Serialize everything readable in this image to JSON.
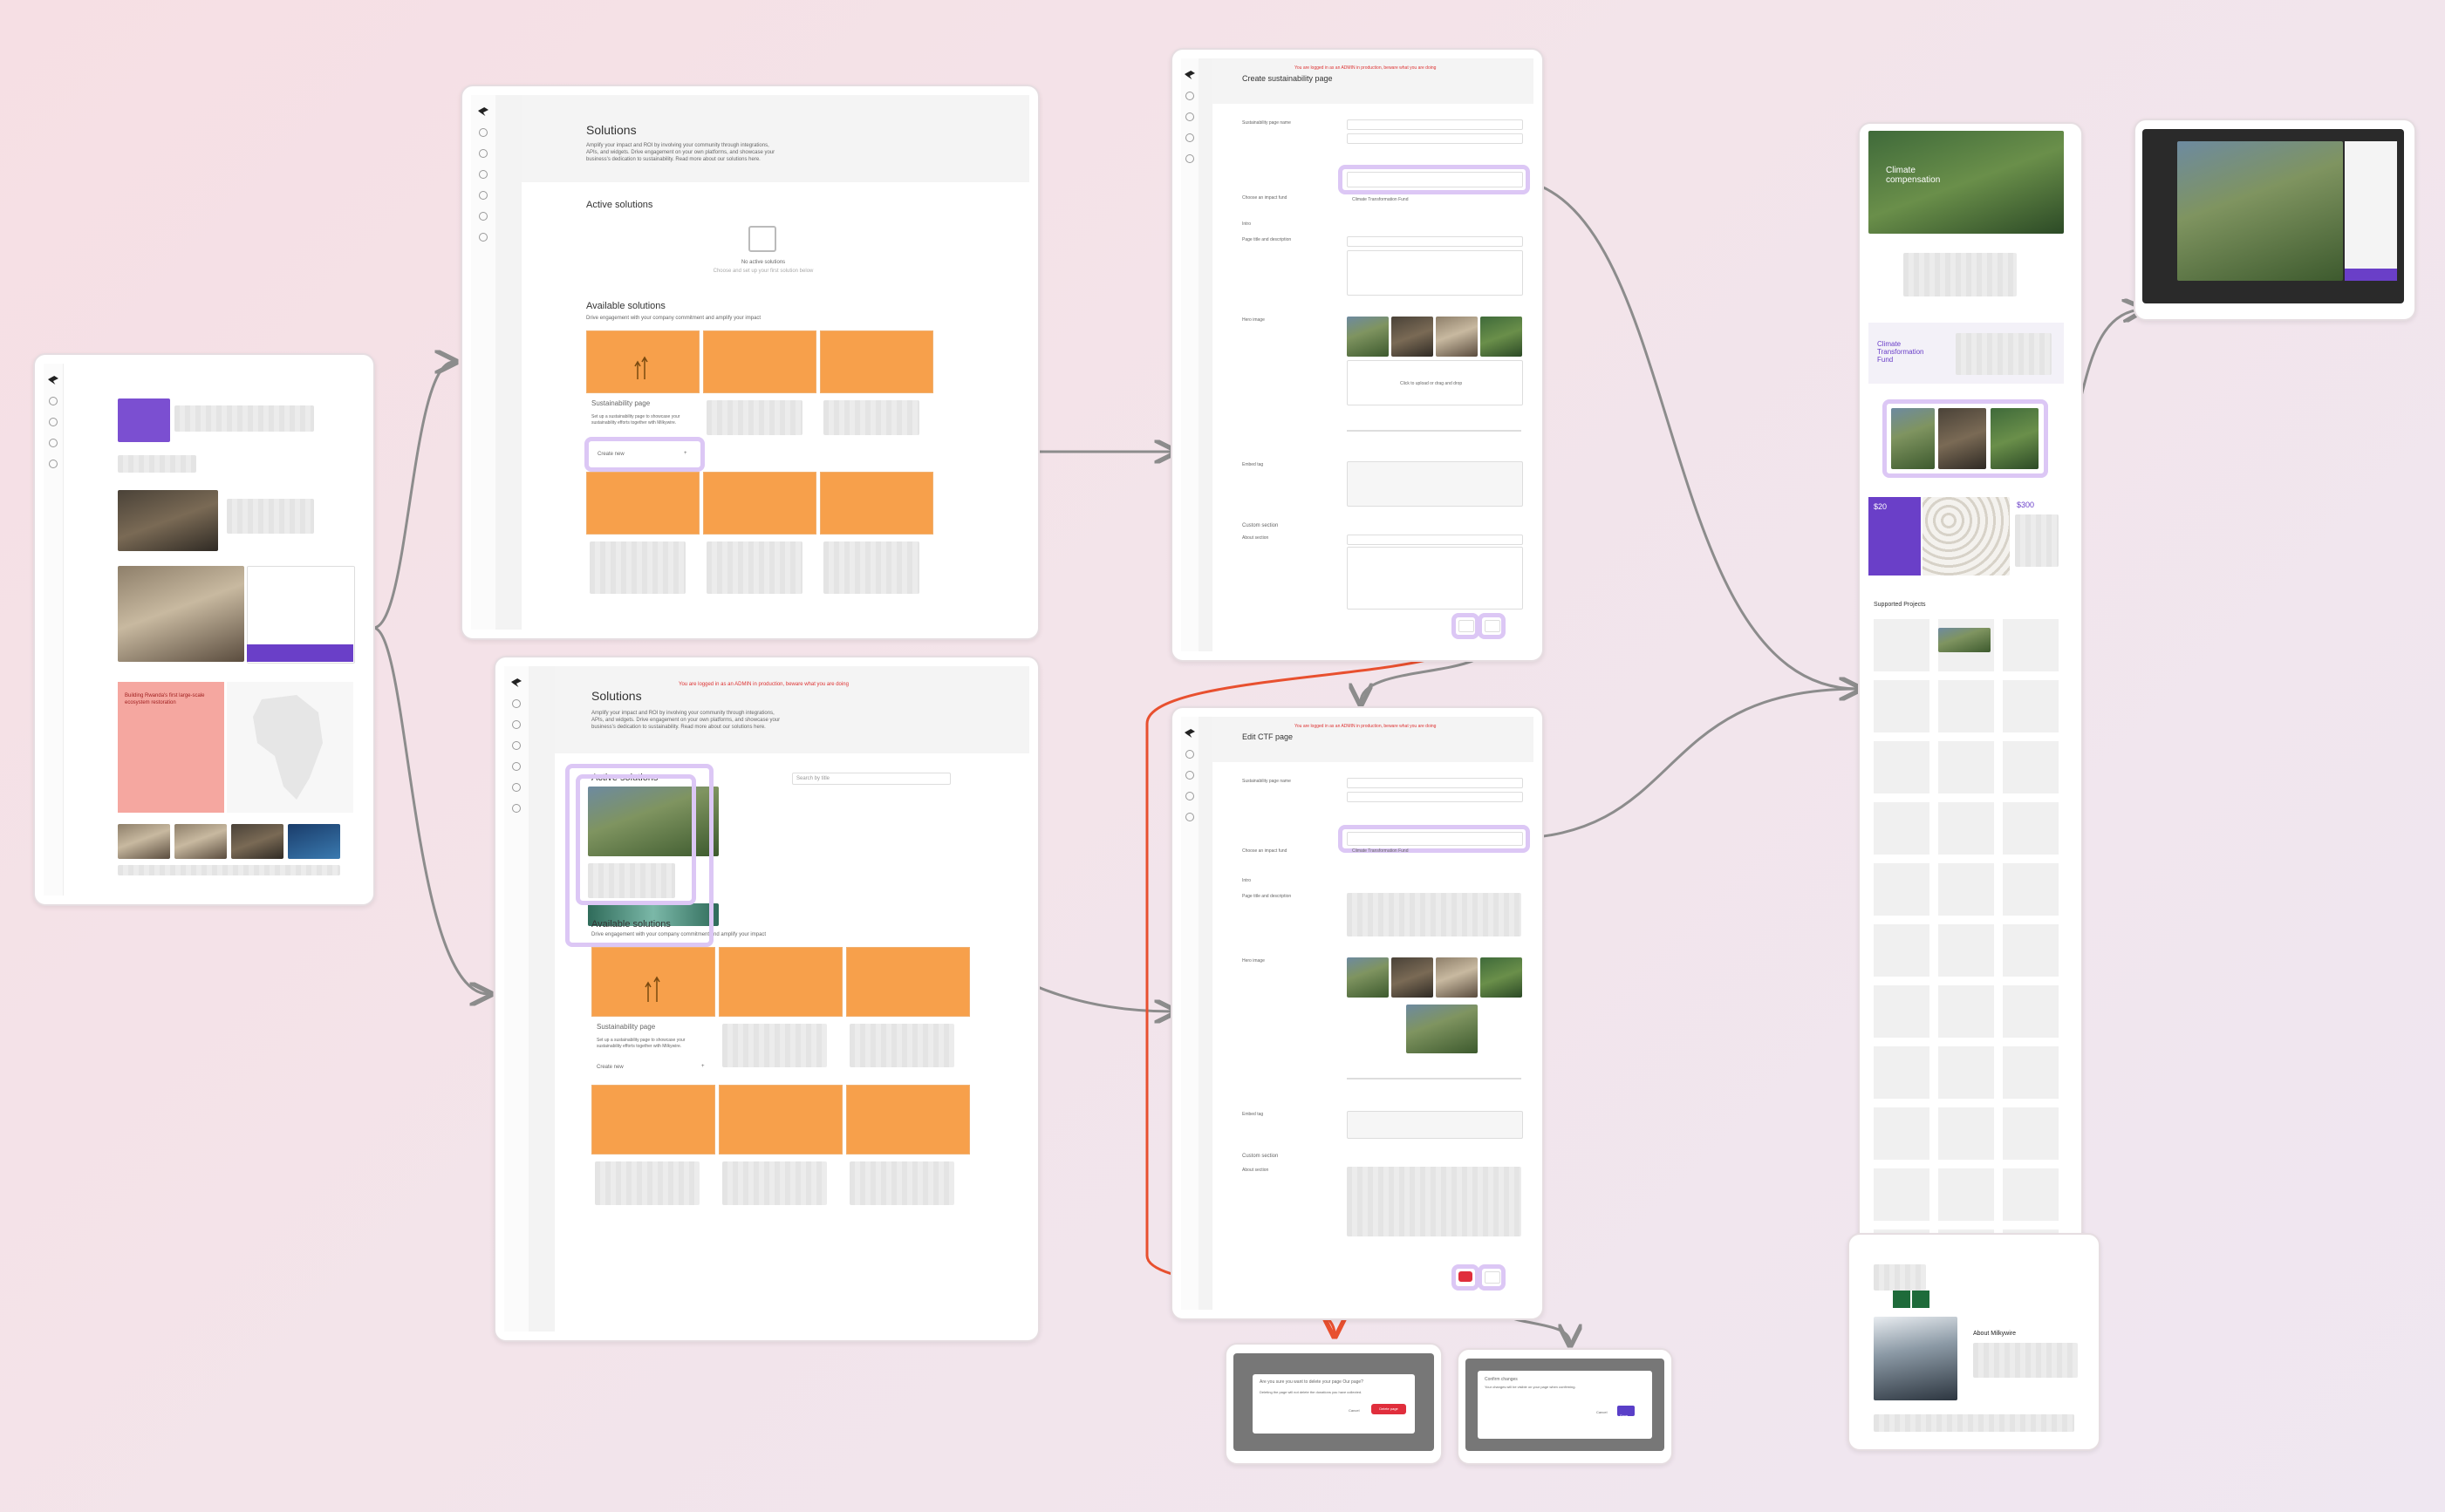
{
  "colors": {
    "accent": "#5a3fc8",
    "highlight": "#dcc7f5",
    "orange": "#f7a04b",
    "delete": "#e02e3c",
    "connector": "#8c8c8c",
    "connector_active": "#e8502f"
  },
  "solutions_a": {
    "title": "Solutions",
    "intro": "Amplify your impact and ROI by involving your community through integrations, APIs, and widgets. Drive engagement on your own platforms, and showcase your business's dedication to sustainability. Read more about our solutions here.",
    "active_heading": "Active solutions",
    "empty_title": "No active solutions",
    "empty_sub": "Choose and set up your first solution below",
    "available_heading": "Available solutions",
    "available_sub": "Drive engagement with your company commitment and amplify your impact",
    "card_title": "Sustainability page",
    "card_desc": "Set up a sustainability page to showcase your sustainability efforts together with Milkywire.",
    "create_label": "Create new",
    "plus": "+"
  },
  "solutions_b": {
    "title": "Solutions",
    "banner": "You are logged in as an ADMIN in production, beware what you are doing",
    "intro": "Amplify your impact and ROI by involving your community through integrations, APIs, and widgets. Drive engagement on your own platforms, and showcase your business's dedication to sustainability. Read more about our solutions here.",
    "active_heading": "Active solutions",
    "search_placeholder": "Search by title",
    "available_heading": "Available solutions",
    "available_sub": "Drive engagement with your company commitment and amplify your impact",
    "card_title": "Sustainability page",
    "card_desc": "Set up a sustainability page to showcase your sustainability efforts together with Milkywire.",
    "create_label": "Create new",
    "plus": "+"
  },
  "create_page": {
    "title": "Create sustainability page",
    "banner": "You are logged in as an ADMIN in production, beware what you are doing",
    "sections": [
      "Sustainability page name",
      "Choose an impact fund",
      "Intro",
      "Page title and description",
      "Hero image",
      "Embed tag",
      "Custom section",
      "About section"
    ],
    "fund_option": "Climate Transformation Fund",
    "upload": "Click to upload or drag and drop",
    "save_label": "Save"
  },
  "edit_page": {
    "title": "Edit CTF page",
    "banner": "You are logged in as an ADMIN in production, beware what you are doing",
    "sections": [
      "Sustainability page name",
      "Choose an impact fund",
      "Intro",
      "Page title and description",
      "Hero image",
      "Embed tag",
      "Custom section",
      "About section"
    ],
    "fund_option": "Climate Transformation Fund",
    "save_label": "Save"
  },
  "modal_delete": {
    "heading": "Are you sure you want to delete your page Our page?",
    "body": "Deleting the page will not delete the donations you have collected.",
    "cancel": "Cancel",
    "confirm": "Delete page"
  },
  "modal_confirm": {
    "heading": "Confirm changes",
    "body": "Your changes will be visible on your page when confirming.",
    "cancel": "Cancel",
    "confirm": "Save"
  },
  "public_page": {
    "hero_title": "Climate compensation",
    "fund_title": "Climate Transformation Fund",
    "price_a": "$20",
    "price_b": "$300",
    "projects_heading": "Supported Projects",
    "about_heading": "About Milkywire"
  },
  "dashboard": {
    "africa_title": "Building Rwanda's first large-scale ecosystem restoration"
  }
}
